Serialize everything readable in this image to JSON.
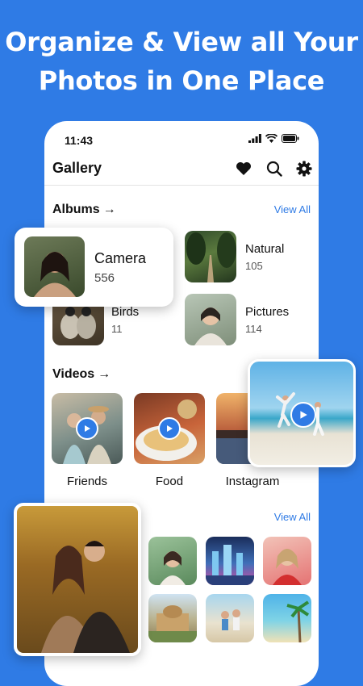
{
  "headline": {
    "line1": "Organize & View all Your",
    "line2": "Photos in One Place"
  },
  "status": {
    "time": "11:43"
  },
  "toolbar": {
    "title": "Gallery",
    "icons": [
      "heart-icon",
      "search-icon",
      "gear-icon"
    ]
  },
  "albums": {
    "title": "Albums",
    "arrow": "→",
    "view_all": "View All",
    "items": [
      {
        "name": "Camera",
        "count": "556"
      },
      {
        "name": "Natural",
        "count": "105"
      },
      {
        "name": "Birds",
        "count": "11"
      },
      {
        "name": "Pictures",
        "count": "114"
      }
    ]
  },
  "videos": {
    "title": "Videos",
    "arrow": "→",
    "items": [
      {
        "label": "Friends"
      },
      {
        "label": "Food"
      },
      {
        "label": "Instagram"
      }
    ]
  },
  "photos": {
    "view_all": "View All"
  },
  "colors": {
    "accent": "#2f7be5",
    "background": "#2f7be5"
  }
}
